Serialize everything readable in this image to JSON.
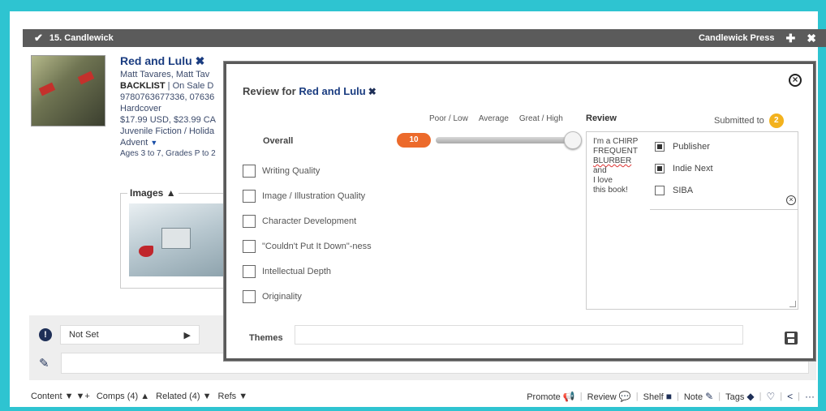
{
  "window": {
    "title": "15. Candlewick",
    "publisher": "Candlewick Press"
  },
  "book": {
    "title": "Red and Lulu",
    "authors": "Matt Tavares, Matt Tav",
    "status_bold": "BACKLIST",
    "status_rest": " | On Sale D",
    "isbn": "9780763677336, 07636",
    "format": "Hardcover",
    "price": "$17.99 USD, $23.99 CA",
    "category": "Juvenile Fiction / Holida",
    "subject": "Advent",
    "ages": "Ages 3 to 7, Grades P to 2",
    "images_label": "Images"
  },
  "panel": {
    "not_set": "Not Set"
  },
  "footer": {
    "content": "Content",
    "comps": "Comps (4)",
    "related": "Related (4)",
    "refs": "Refs",
    "promote": "Promote",
    "review": "Review",
    "shelf": "Shelf",
    "note": "Note",
    "tags": "Tags"
  },
  "modal": {
    "title_prefix": "Review for ",
    "book_title": "Red and Lulu",
    "scale": [
      "Poor / Low",
      "Average",
      "Great / High"
    ],
    "review_heading": "Review",
    "submitted_label": "Submitted to",
    "submitted_count": "2",
    "overall_label": "Overall",
    "overall_score": "10",
    "overall_level": 1.0,
    "criteria": [
      "Writing Quality",
      "Image / Illustration Quality",
      "Character Development",
      "\"Couldn't Put It Down\"-ness",
      "Intellectual Depth",
      "Originality"
    ],
    "review_lines": [
      "I'm a CHIRP",
      "FREQUENT",
      "BLURBER",
      "and",
      "I love",
      "this book!"
    ],
    "destinations": [
      {
        "label": "Publisher",
        "checked": true
      },
      {
        "label": "Indie Next",
        "checked": true
      },
      {
        "label": "SIBA",
        "checked": false
      }
    ],
    "themes_label": "Themes"
  },
  "colors": {
    "frame": "#2ec4d1",
    "titlebar": "#5b5b5b",
    "accent_orange": "#ec6a2b",
    "badge_yellow": "#f3b21d",
    "link_blue": "#1a3c80"
  }
}
